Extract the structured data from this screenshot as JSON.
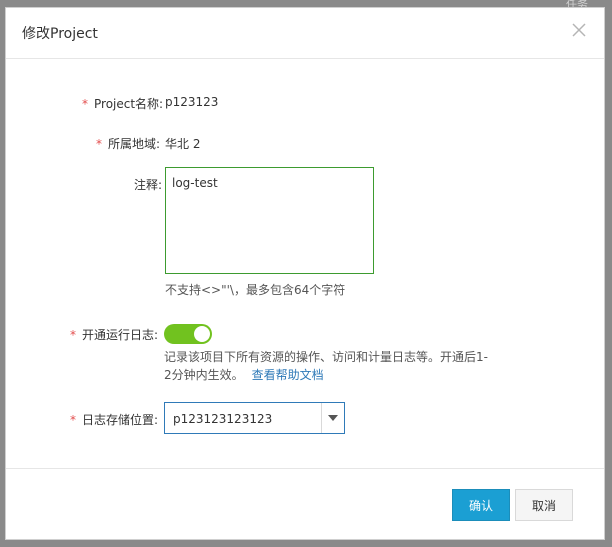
{
  "backdrop": {
    "corner_text": "任务"
  },
  "dialog": {
    "title": "修改Project",
    "fields": {
      "project_name": {
        "label": "Project名称:",
        "value": "p123123",
        "required": true
      },
      "region": {
        "label": "所属地域:",
        "value": "华北 2",
        "required": true
      },
      "remark": {
        "label": "注释:",
        "value": "log-test",
        "hint": "不支持<>\"'\\，最多包含64个字符"
      },
      "run_log": {
        "label": "开通运行日志:",
        "required": true,
        "enabled": true,
        "description": "记录该项目下所有资源的操作、访问和计量日志等。开通后1-2分钟内生效。",
        "help_link": "查看帮助文档"
      },
      "log_store": {
        "label": "日志存储位置:",
        "value": "p123123123123",
        "required": true
      }
    },
    "buttons": {
      "confirm": "确认",
      "cancel": "取消"
    }
  },
  "colors": {
    "primary": "#1b9fd3",
    "toggle_on": "#71c21f",
    "required_star": "#e34d4d",
    "link": "#2f7ab8",
    "textarea_border": "#3d9b2f"
  }
}
